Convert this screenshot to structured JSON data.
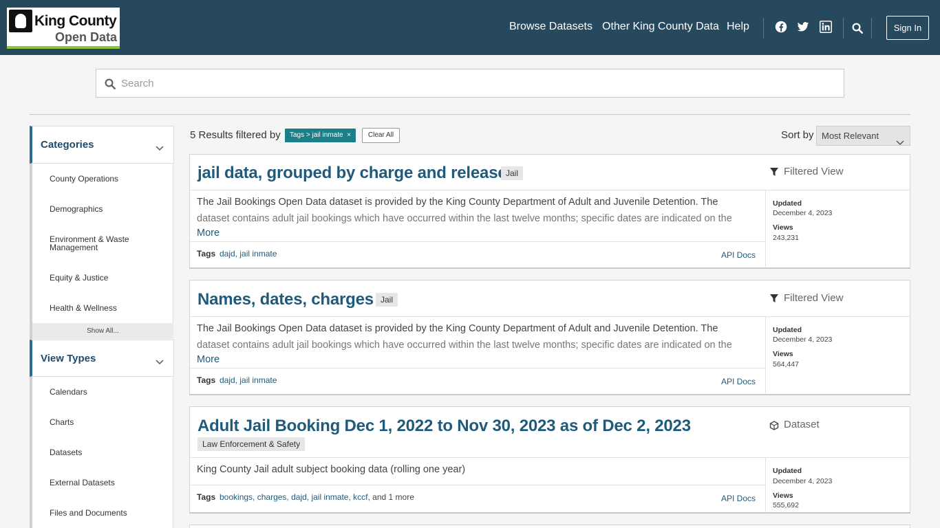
{
  "header": {
    "logo_line1": "King County",
    "logo_line2": "Open Data",
    "nav": [
      "Browse Datasets",
      "Other King County Data",
      "Help"
    ],
    "signin_label": "Sign In"
  },
  "search": {
    "placeholder": "Search"
  },
  "sidebar": {
    "categories": {
      "title": "Categories",
      "items": [
        "County Operations",
        "Demographics",
        "Environment & Waste Management",
        "Equity & Justice",
        "Health & Wellness"
      ],
      "show_all": "Show All..."
    },
    "view_types": {
      "title": "View Types",
      "items": [
        "Calendars",
        "Charts",
        "Datasets",
        "External Datasets",
        "Files and Documents"
      ]
    }
  },
  "results": {
    "count_text": "5 Results filtered by",
    "filter_pill": "Tags > jail inmate",
    "filter_close": "×",
    "clear_label": "Clear All",
    "sort_label": "Sort by",
    "sort_value": "Most Relevant"
  },
  "cards": [
    {
      "title": "jail data, grouped by charge and release",
      "category": "Jail",
      "type": "Filtered View",
      "desc_line1": "The Jail Bookings Open Data dataset is provided by the King County Department of Adult and Juvenile Detention. The",
      "desc_line2": "dataset contains adult jail bookings which have occurred within the last twelve months; specific dates are indicated on the",
      "more": "More",
      "tags_label": "Tags",
      "tags": [
        "dajd",
        "jail inmate"
      ],
      "api": "API Docs",
      "updated_label": "Updated",
      "updated": "December 4, 2023",
      "views_label": "Views",
      "views": "243,231"
    },
    {
      "title": "Names, dates, charges",
      "category": "Jail",
      "type": "Filtered View",
      "desc_line1": "The Jail Bookings Open Data dataset is provided by the King County Department of Adult and Juvenile Detention. The",
      "desc_line2": "dataset contains adult jail bookings which have occurred within the last twelve months; specific dates are indicated on the",
      "more": "More",
      "tags_label": "Tags",
      "tags": [
        "dajd",
        "jail inmate"
      ],
      "api": "API Docs",
      "updated_label": "Updated",
      "updated": "December 4, 2023",
      "views_label": "Views",
      "views": "564,447"
    },
    {
      "title": "Adult Jail Booking Dec 1, 2022 to Nov 30, 2023 as of Dec 2, 2023",
      "category": "Law Enforcement & Safety",
      "type": "Dataset",
      "desc_line1": "King County Jail adult subject booking data (rolling one year)",
      "tags_label": "Tags",
      "tags": [
        "bookings",
        "charges",
        "dajd",
        "jail inmate",
        "kccf"
      ],
      "tags_more": ", and 1 more",
      "api": "API Docs",
      "updated_label": "Updated",
      "updated": "December 4, 2023",
      "views_label": "Views",
      "views": "555,692"
    }
  ],
  "colors": {
    "header": "#27495e",
    "accent": "#1b7f89",
    "link": "#1f5a7a",
    "logo_bar": "#8cc63f"
  },
  "icons": [
    "facebook-icon",
    "twitter-icon",
    "linkedin-icon",
    "search-icon",
    "chevron-down-icon",
    "filter-icon",
    "dataset-icon"
  ]
}
